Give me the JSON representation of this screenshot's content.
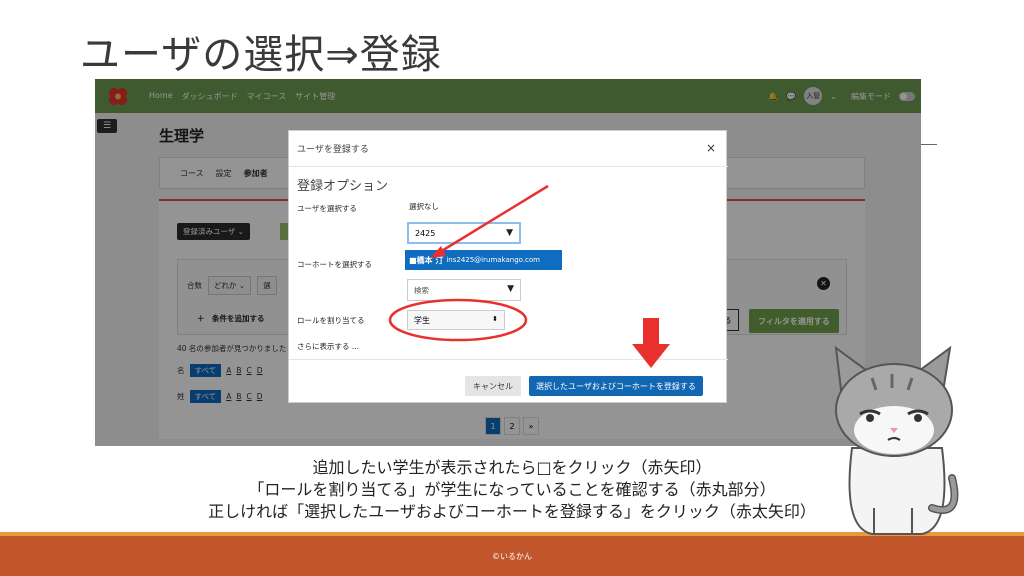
{
  "slide": {
    "title": "ユーザの選択⇒登録",
    "caption_lines": [
      "追加したい学生が表示されたら□をクリック（赤矢印）",
      "「ロールを割り当てる」が学生になっていることを確認する（赤丸部分）",
      "正しければ「選択したユーザおよびコーホートを登録する」をクリック（赤太矢印）"
    ],
    "footer": "©いるかん"
  },
  "navbar": {
    "links": [
      "Home",
      "ダッシュボード",
      "マイコース",
      "サイト管理"
    ],
    "avatar": "入管",
    "edit_mode": "編集モード"
  },
  "page": {
    "drawer": "☰",
    "course_title": "生理学",
    "tabs": [
      "コース",
      "設定",
      "参加者"
    ],
    "enrolled_users_btn": "登録済みユーザ ⌄",
    "filter": {
      "match_label": "合数",
      "match_value": "どれか",
      "second_select": "選",
      "add_condition": "＋　条件を追加する",
      "outline_btn": "る",
      "apply": "フィルタを適用する"
    },
    "found": "40 名の参加者が見つかりました",
    "first_name_label": "名",
    "last_name_label": "姓",
    "all_label": "すべて",
    "letters": [
      "A",
      "B",
      "C",
      "D"
    ],
    "pages": [
      "1",
      "2",
      "»"
    ]
  },
  "modal": {
    "title": "ユーザを登録する",
    "close": "×",
    "options_heading": "登録オプション",
    "select_users_label": "ユーザを選択する",
    "selection_none": "選択なし",
    "user_input": "2425",
    "suggestion_name": "■橋本 汀",
    "suggestion_email": "ins2425@irumakango.com",
    "cohort_label": "コーホートを選択する",
    "cohort_placeholder": "検索",
    "role_label": "ロールを割り当てる",
    "role_value": "学生",
    "show_more": "さらに表示する ...",
    "cancel": "キャンセル",
    "enrol": "選択したユーザおよびコーホートを登録する"
  },
  "colors": {
    "navbar": "#6f9b52",
    "primary": "#0f6cbf",
    "annotation_red": "#e8312e",
    "footer": "#c0562a",
    "footer_stripe": "#e69a3a"
  }
}
